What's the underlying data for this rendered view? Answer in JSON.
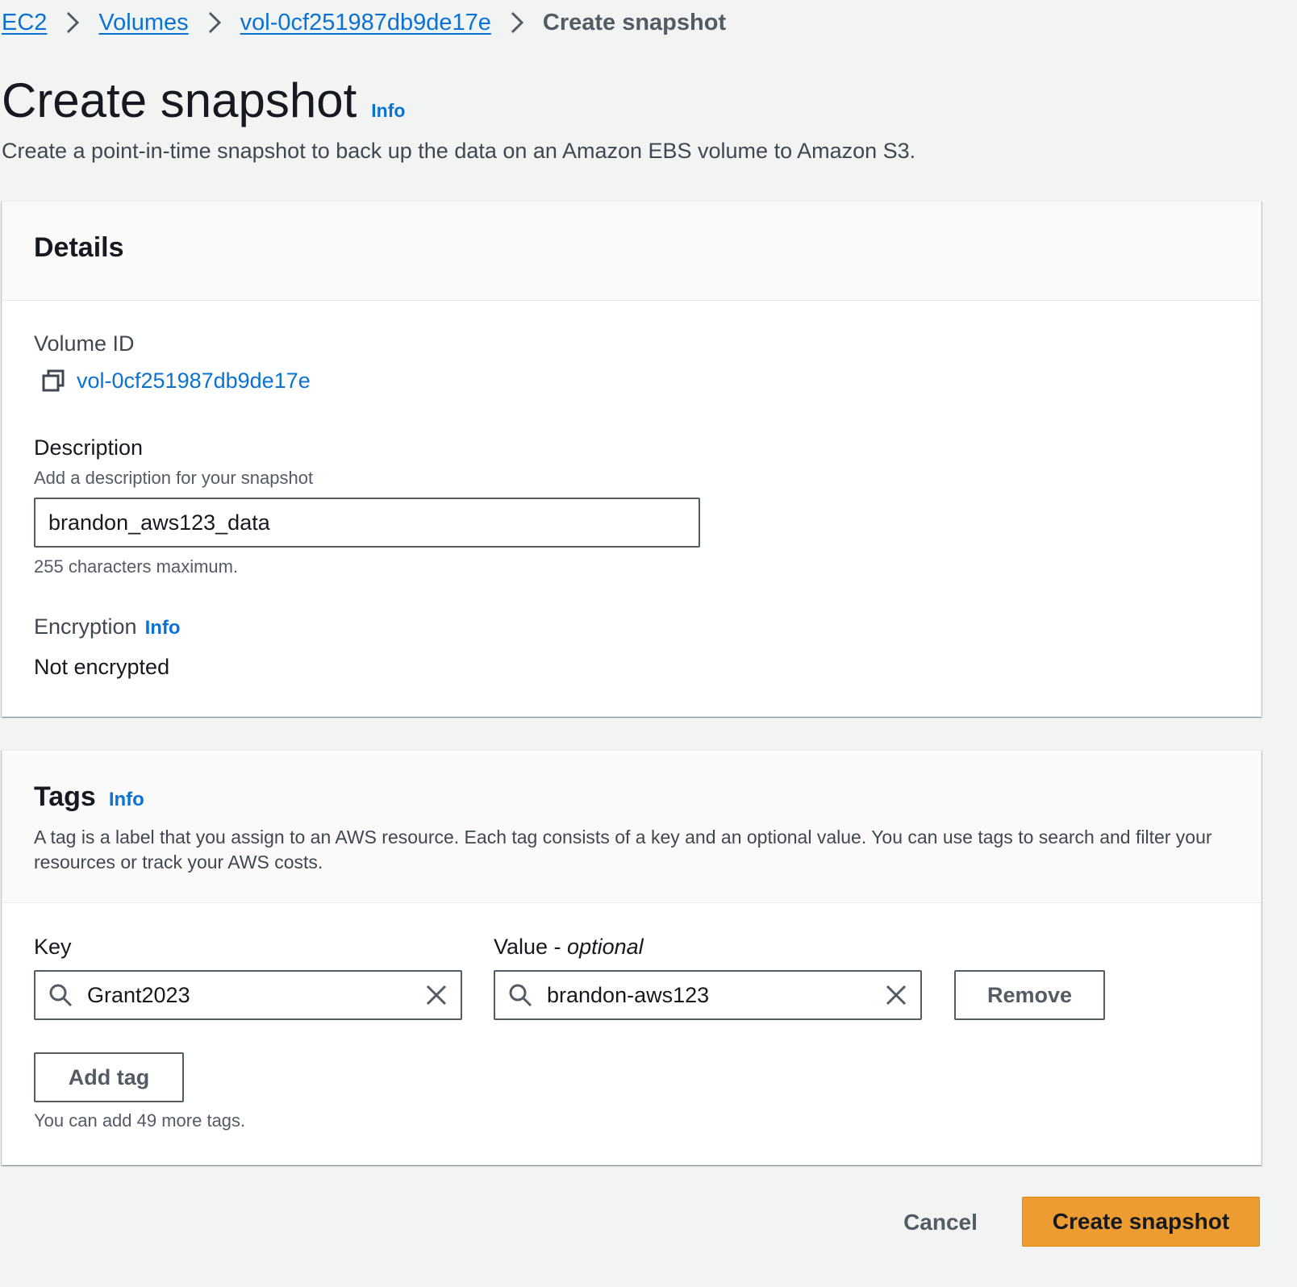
{
  "breadcrumb": {
    "items": [
      "EC2",
      "Volumes",
      "vol-0cf251987db9de17e"
    ],
    "current": "Create snapshot"
  },
  "header": {
    "title": "Create snapshot",
    "info": "Info",
    "description": "Create a point-in-time snapshot to back up the data on an Amazon EBS volume to Amazon S3."
  },
  "details": {
    "title": "Details",
    "volume_id_label": "Volume ID",
    "volume_id": "vol-0cf251987db9de17e",
    "description_label": "Description",
    "description_hint": "Add a description for your snapshot",
    "description_value": "brandon_aws123_data",
    "description_constraint": "255 characters maximum.",
    "encryption_label": "Encryption",
    "encryption_info": "Info",
    "encryption_value": "Not encrypted"
  },
  "tags": {
    "title": "Tags",
    "info": "Info",
    "description": "A tag is a label that you assign to an AWS resource. Each tag consists of a key and an optional value. You can use tags to search and filter your resources or track your AWS costs.",
    "key_label": "Key",
    "value_label": "Value - ",
    "value_optional": "optional",
    "key_value": "Grant2023",
    "value_value": "brandon-aws123",
    "remove_label": "Remove",
    "add_tag_label": "Add tag",
    "remaining_hint": "You can add 49 more tags."
  },
  "footer": {
    "cancel_label": "Cancel",
    "create_label": "Create snapshot"
  },
  "colors": {
    "link": "#0972d3",
    "primary_button": "#ec9c30",
    "background": "#f2f3f3"
  },
  "icons": [
    "chevron-right-icon",
    "copy-icon",
    "search-icon",
    "close-icon"
  ]
}
